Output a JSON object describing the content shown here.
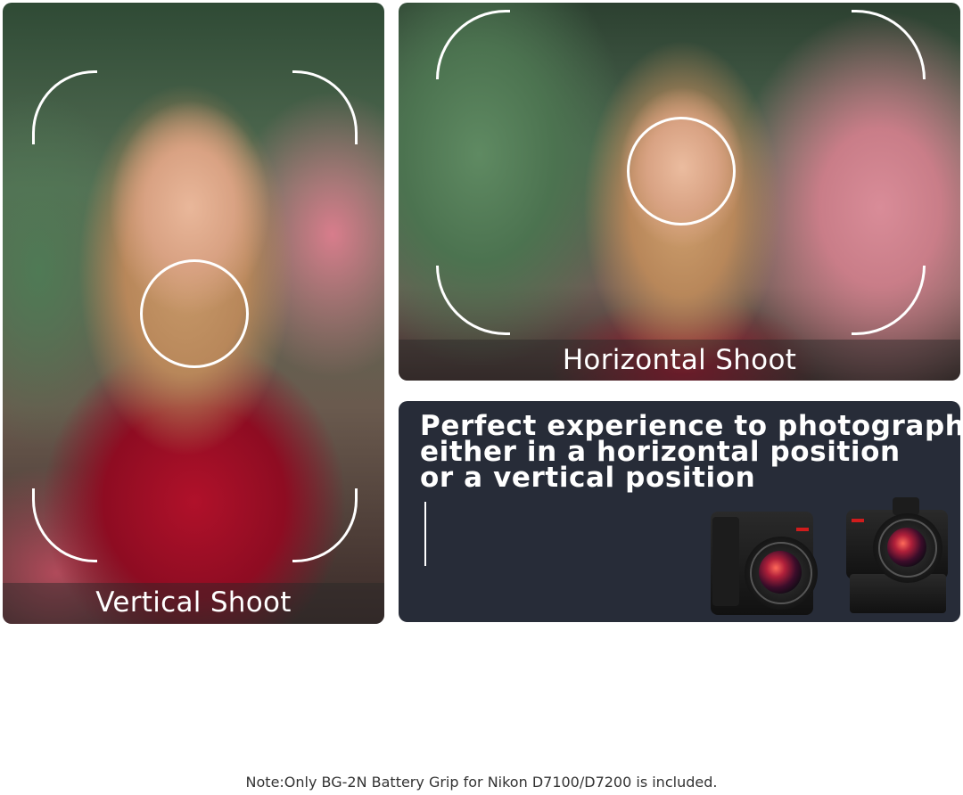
{
  "vertical_shoot": {
    "caption": "Vertical Shoot"
  },
  "horizontal_shoot": {
    "caption": "Horizontal Shoot"
  },
  "info_panel": {
    "headline_lines": [
      "Perfect experience to photograph",
      "either in a horizontal position",
      "or a vertical position"
    ]
  },
  "footer": {
    "note": "Note:Only BG-2N Battery Grip for Nikon D7100/D7200 is included."
  },
  "colors": {
    "panel_bg": "#272c38",
    "frame_white": "#ffffff",
    "lens_red": "#d01c1c"
  }
}
